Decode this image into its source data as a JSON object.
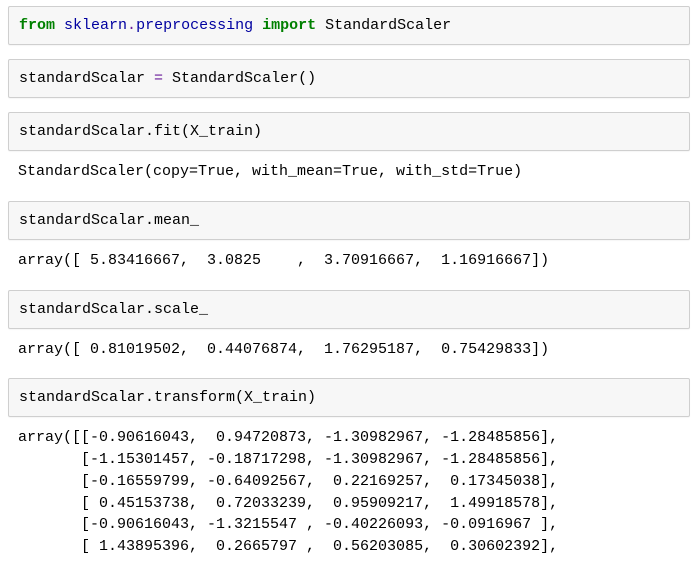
{
  "cells": {
    "c1": {
      "kw_from": "from",
      "mod1": "sklearn",
      "dot1": ".",
      "mod2": "preprocessing ",
      "kw_import": "import",
      "name": " StandardScaler"
    },
    "c2": {
      "lhs": "standardScalar ",
      "op": "=",
      "rhs": " StandardScaler()"
    },
    "c3": {
      "code": "standardScalar.fit(X_train)",
      "out": "StandardScaler(copy=True, with_mean=True, with_std=True)"
    },
    "c4": {
      "code": "standardScalar.mean_",
      "out": "array([ 5.83416667,  3.0825    ,  3.70916667,  1.16916667])"
    },
    "c5": {
      "code": "standardScalar.scale_",
      "out": "array([ 0.81019502,  0.44076874,  1.76295187,  0.75429833])"
    },
    "c6": {
      "code": "standardScalar.transform(X_train)",
      "out": "array([[-0.90616043,  0.94720873, -1.30982967, -1.28485856],\n       [-1.15301457, -0.18717298, -1.30982967, -1.28485856],\n       [-0.16559799, -0.64092567,  0.22169257,  0.17345038],\n       [ 0.45153738,  0.72033239,  0.95909217,  1.49918578],\n       [-0.90616043, -1.3215547 , -0.40226093, -0.0916967 ],\n       [ 1.43895396,  0.2665797 ,  0.56203085,  0.30602392],"
    }
  }
}
